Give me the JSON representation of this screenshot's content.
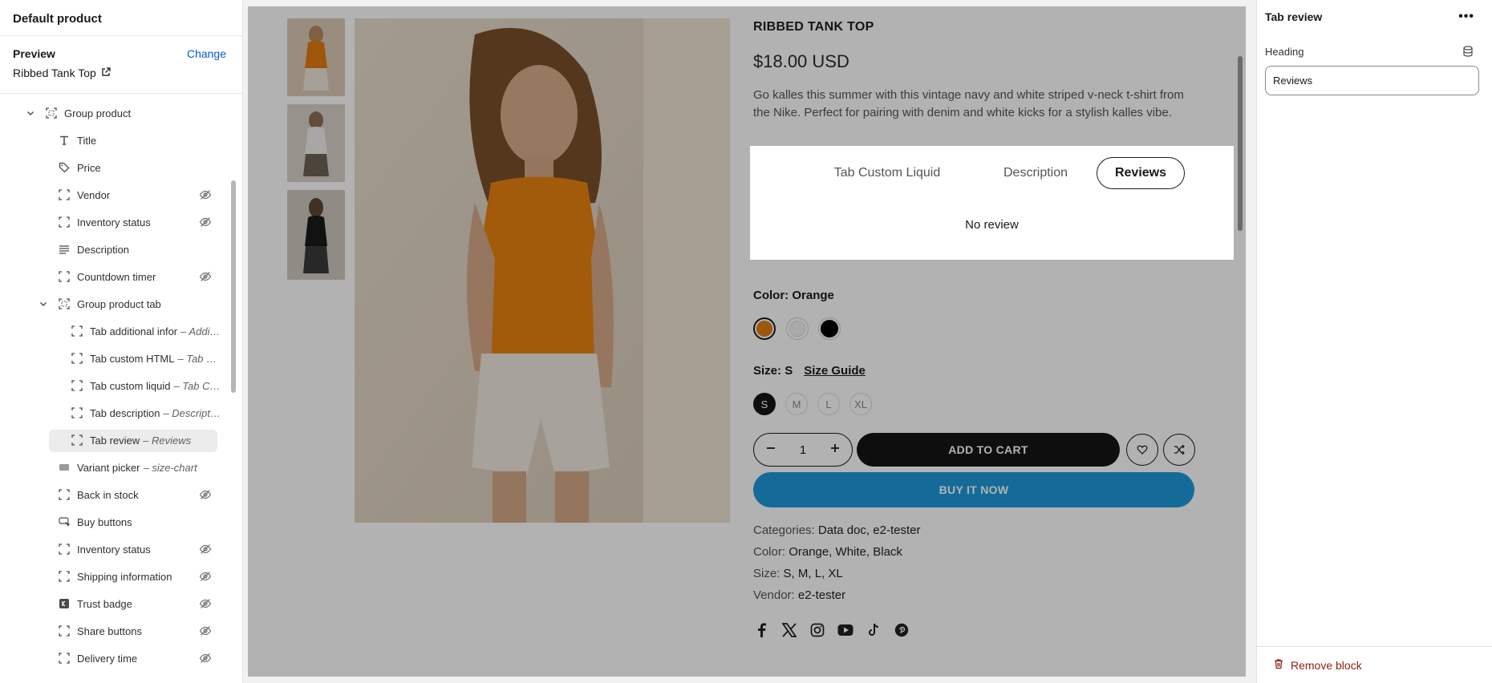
{
  "left_panel": {
    "title": "Default product",
    "preview_label": "Preview",
    "change_label": "Change",
    "preview_product": "Ribbed Tank Top",
    "tree": [
      {
        "label": "Group product",
        "sub": "",
        "icon": "group-icon",
        "hidden": false,
        "level": 0,
        "expanded": true
      },
      {
        "label": "Title",
        "sub": "",
        "icon": "text-icon",
        "hidden": false,
        "level": 1
      },
      {
        "label": "Price",
        "sub": "",
        "icon": "price-tag-icon",
        "hidden": false,
        "level": 1
      },
      {
        "label": "Vendor",
        "sub": "",
        "icon": "block-icon",
        "hidden": true,
        "level": 1
      },
      {
        "label": "Inventory status",
        "sub": "",
        "icon": "block-icon",
        "hidden": true,
        "level": 1
      },
      {
        "label": "Description",
        "sub": "",
        "icon": "paragraph-icon",
        "hidden": false,
        "level": 1
      },
      {
        "label": "Countdown timer",
        "sub": "",
        "icon": "block-icon",
        "hidden": true,
        "level": 1
      },
      {
        "label": "Group product tab",
        "sub": "",
        "icon": "group-icon",
        "hidden": false,
        "level": 1,
        "expanded": true
      },
      {
        "label": "Tab additional infor",
        "sub": "– Additional information",
        "icon": "block-icon",
        "hidden": false,
        "level": 2
      },
      {
        "label": "Tab custom HTML",
        "sub": "– Tab Custom HTML",
        "icon": "block-icon",
        "hidden": false,
        "level": 2
      },
      {
        "label": "Tab custom liquid",
        "sub": "– Tab Custom Liquid",
        "icon": "block-icon",
        "hidden": false,
        "level": 2
      },
      {
        "label": "Tab description",
        "sub": "– Description",
        "icon": "block-icon",
        "hidden": false,
        "level": 2
      },
      {
        "label": "Tab review",
        "sub": "– Reviews",
        "icon": "block-icon",
        "hidden": false,
        "level": 2,
        "selected": true
      },
      {
        "label": "Variant picker",
        "sub": "– size-chart",
        "icon": "variant-icon",
        "hidden": false,
        "level": 1
      },
      {
        "label": "Back in stock",
        "sub": "",
        "icon": "block-icon",
        "hidden": true,
        "level": 1
      },
      {
        "label": "Buy buttons",
        "sub": "",
        "icon": "cursor-icon",
        "hidden": false,
        "level": 1
      },
      {
        "label": "Inventory status",
        "sub": "",
        "icon": "block-icon",
        "hidden": true,
        "level": 1
      },
      {
        "label": "Shipping information",
        "sub": "",
        "icon": "block-icon",
        "hidden": true,
        "level": 1
      },
      {
        "label": "Trust badge",
        "sub": "",
        "icon": "badge-icon",
        "hidden": true,
        "level": 1
      },
      {
        "label": "Share buttons",
        "sub": "",
        "icon": "block-icon",
        "hidden": true,
        "level": 1
      },
      {
        "label": "Delivery time",
        "sub": "",
        "icon": "block-icon",
        "hidden": true,
        "level": 1
      }
    ]
  },
  "product": {
    "title": "RIBBED TANK TOP",
    "price": "$18.00 USD",
    "description": "Go kalles this summer with this vintage navy and white striped v-neck t-shirt from the Nike. Perfect for pairing with denim and white kicks for a stylish kalles vibe.",
    "tabs": [
      "Tab Custom Liquid",
      "Description",
      "Reviews"
    ],
    "active_tab": "Reviews",
    "tab_content": "No review",
    "color_label": "Color:",
    "color_value": "Orange",
    "swatch_colors": [
      "#e07d0f",
      "#f2f2f2",
      "#000000"
    ],
    "size_label": "Size:",
    "size_value": "S",
    "size_guide": "Size Guide",
    "sizes": [
      "S",
      "M",
      "L",
      "XL"
    ],
    "quantity": "1",
    "add_to_cart": "ADD TO CART",
    "buy_now": "BUY IT NOW",
    "meta": [
      {
        "label": "Categories:",
        "value": "Data doc, e2-tester"
      },
      {
        "label": "Color:",
        "value": "Orange, White, Black"
      },
      {
        "label": "Size:",
        "value": "S, M, L, XL"
      },
      {
        "label": "Vendor:",
        "value": "e2-tester"
      }
    ],
    "social_icons": [
      "facebook-icon",
      "x-icon",
      "instagram-icon",
      "youtube-icon",
      "tiktok-icon",
      "pinterest-icon"
    ]
  },
  "right_panel": {
    "title": "Tab review",
    "heading_label": "Heading",
    "heading_value": "Reviews",
    "remove_label": "Remove block"
  },
  "colors": {
    "accent_link": "#005bd3",
    "buy_now": "#1d9ad9",
    "remove": "#8e1f0b"
  }
}
